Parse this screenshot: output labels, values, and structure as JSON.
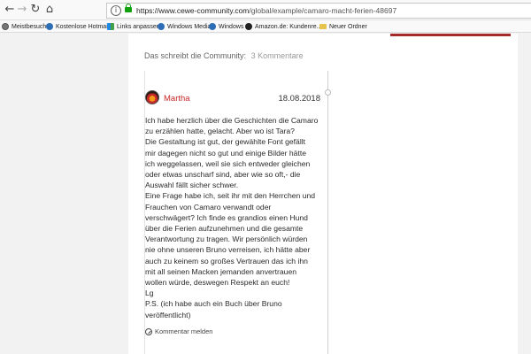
{
  "toolbar": {
    "back_icon": "back-arrow-icon",
    "forward_icon": "forward-arrow-icon",
    "reload_icon": "reload-icon",
    "home_icon": "home-icon",
    "url_host": "https://www.cewe-community.com",
    "url_path": "/global/example/camaro-macht-ferien-48697"
  },
  "bookmarks": [
    {
      "label": "Meistbesucht",
      "icon": "gear-icon"
    },
    {
      "label": "Kostenlose Hotmail",
      "icon": "globe-icon"
    },
    {
      "label": "Links anpassen",
      "icon": "grid-icon"
    },
    {
      "label": "Windows Media",
      "icon": "globe-icon"
    },
    {
      "label": "Windows",
      "icon": "globe-icon"
    },
    {
      "label": "Amazon.de: Kundenre...",
      "icon": "amazon-icon"
    },
    {
      "label": "Neuer Ordner",
      "icon": "folder-icon"
    }
  ],
  "community": {
    "header": "Das schreibt die Community:",
    "count": "3 Kommentare"
  },
  "comment": {
    "author": "Martha",
    "date": "18.08.2018",
    "lines": [
      "Ich habe herzlich über die Geschichten die Camaro",
      "zu erzählen hatte, gelacht. Aber wo ist Tara?",
      "Die Gestaltung ist gut, der gewählte Font gefällt",
      "mir dagegen nicht so gut und einige Bilder hätte",
      "ich weggelassen, weil sie sich entweder gleichen",
      "oder etwas unscharf sind, aber wie so oft,- die",
      "Auswahl fällt sicher schwer.",
      "Eine Frage habe ich, seit ihr mit den Herrchen und",
      "Frauchen von Camaro verwandt oder",
      "verschwägert? Ich finde es grandios einen Hund",
      "über die Ferien aufzunehmen und die gesamte",
      "Verantwortung zu tragen. Wir persönlich würden",
      "nie ohne unseren Bruno verreisen, ich hätte aber",
      "auch zu keinem so großes Vertrauen das ich ihn",
      "mit all seinen Macken jemanden anvertrauen",
      "wollen würde, deswegen Respekt an euch!",
      "Lg",
      "P.S. (ich habe auch ein Buch über Bruno",
      "veröffentlicht)"
    ],
    "report_label": "Kommentar melden"
  }
}
